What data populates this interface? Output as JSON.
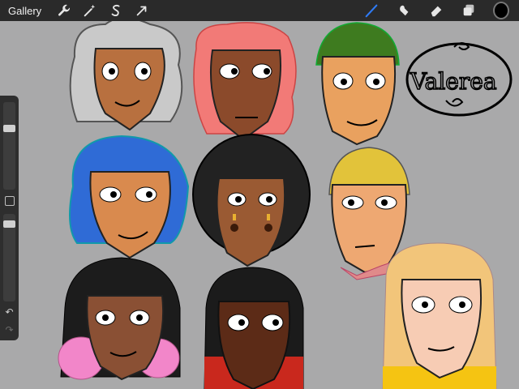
{
  "toolbar": {
    "gallery_label": "Gallery",
    "left_tools": [
      "wrench-icon",
      "magic-wand-icon",
      "selection-icon",
      "transform-arrow-icon"
    ],
    "right_tools": [
      "brush-icon",
      "smudge-icon",
      "eraser-icon",
      "layers-icon"
    ],
    "active_tool": "brush-icon",
    "active_color": "#000000",
    "brush_accent": "#2f7bf5"
  },
  "sidebar": {
    "brush_size_level": 0.28,
    "opacity_level": 0.08,
    "undo_icon": "undo-arrow-icon",
    "redo_icon": "redo-arrow-icon"
  },
  "artwork": {
    "signature_text": "Valerea",
    "characters": [
      {
        "id": "gray-curly",
        "hair": "#c8c8c8",
        "skin": "#b8703f"
      },
      {
        "id": "pink-fluffy",
        "hair": "#f27a77",
        "skin": "#8b4a2b"
      },
      {
        "id": "green-beanie",
        "hair": "#3e7b1f",
        "skin": "#e9a15f"
      },
      {
        "id": "blue-bob",
        "hair": "#2f6bd6",
        "skin": "#d98a4e"
      },
      {
        "id": "black-afro",
        "hair": "#222222",
        "skin": "#9a5a33"
      },
      {
        "id": "yellow-cap",
        "hair": "#e2c33a",
        "skin": "#eea872"
      },
      {
        "id": "black-pink-curls",
        "hair": "#1c1c1c",
        "skin": "#8a5034",
        "tips": "#f286c9"
      },
      {
        "id": "black-red-braids",
        "hair": "#1b1b1b",
        "skin": "#5c2b17",
        "tips": "#c9281d"
      },
      {
        "id": "blonde-long",
        "hair": "#f2c57a",
        "skin": "#f7ccb4",
        "tips": "#f5c412"
      }
    ]
  }
}
